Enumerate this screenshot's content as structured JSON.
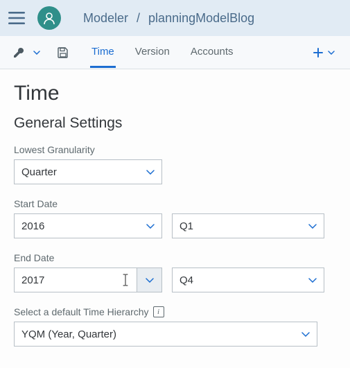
{
  "breadcrumb": {
    "item1": "Modeler",
    "sep": "/",
    "item2": "planningModelBlog"
  },
  "tabs": {
    "time": "Time",
    "version": "Version",
    "accounts": "Accounts"
  },
  "page": {
    "title": "Time",
    "section": "General Settings"
  },
  "labels": {
    "lowest_granularity": "Lowest Granularity",
    "start_date": "Start Date",
    "end_date": "End Date",
    "default_hierarchy": "Select a default Time Hierarchy"
  },
  "values": {
    "granularity": "Quarter",
    "start_year": "2016",
    "start_quarter": "Q1",
    "end_year": "2017",
    "end_quarter": "Q4",
    "hierarchy": "YQM (Year, Quarter)"
  },
  "colors": {
    "accent": "#1b6dd1",
    "avatar": "#2f8f8a"
  }
}
